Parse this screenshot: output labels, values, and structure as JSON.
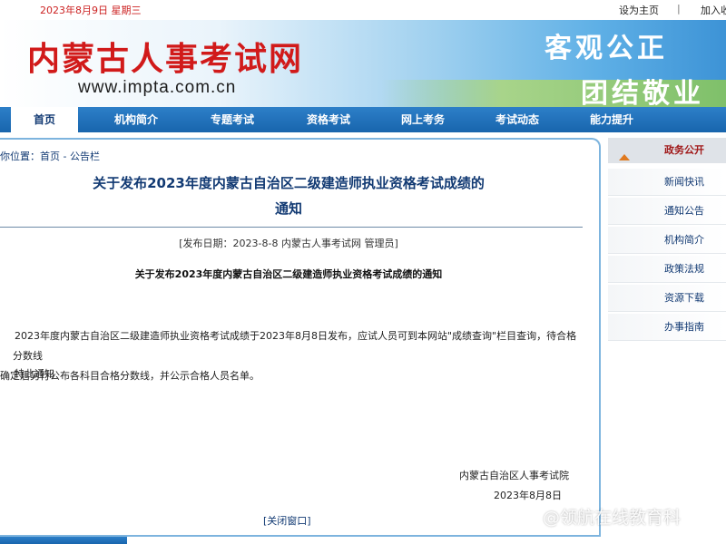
{
  "topbar": {
    "date": "2023年8月9日 星期三",
    "set_home": "设为主页",
    "separator": "|",
    "add_fav": "加入收"
  },
  "banner": {
    "site_title": "内蒙古人事考试网",
    "url": "www.impta.com.cn",
    "slogan_line1": "客观公正",
    "slogan_line2": "团结敬业"
  },
  "nav": {
    "items": [
      "首页",
      "机构简介",
      "专题考试",
      "资格考试",
      "网上考务",
      "考试动态",
      "能力提升"
    ],
    "active_index": 0
  },
  "breadcrumb": {
    "prefix": "你位置：",
    "home": "首页",
    "sep": " - ",
    "current": "公告栏"
  },
  "article": {
    "title_line1": "关于发布2023年度内蒙古自治区二级建造师执业资格考试成绩的",
    "title_line2": "通知",
    "meta": "[发布日期：2023-8-8 内蒙古人事考试网 管理员]",
    "subtitle": "关于发布2023年度内蒙古自治区二级建造师执业资格考试成绩的通知",
    "body_line1": "2023年度内蒙古自治区二级建造师执业资格考试成绩于2023年8月8日发布，应试人员可到本网站\"成绩查询\"栏目查询，待合格分数线",
    "body_line2": "确定后另行公布各科目合格分数线，并公示合格人员名单。",
    "notice": "特此通知",
    "org": "内蒙古自治区人事考试院",
    "date": "2023年8月8日",
    "close_label": "[关闭窗口]"
  },
  "sidebar": {
    "header": "政务公开",
    "items": [
      "新闻快讯",
      "通知公告",
      "机构简介",
      "政策法规",
      "资源下载",
      "办事指南"
    ]
  },
  "watermark": "@领航在线教育科",
  "colors": {
    "nav_bg": "#1865ad",
    "title_blue": "#123a73",
    "date_red": "#cc2222",
    "logo_red": "#d11a1a",
    "side_head_red": "#a01818",
    "accent_orange": "#e07a20"
  }
}
